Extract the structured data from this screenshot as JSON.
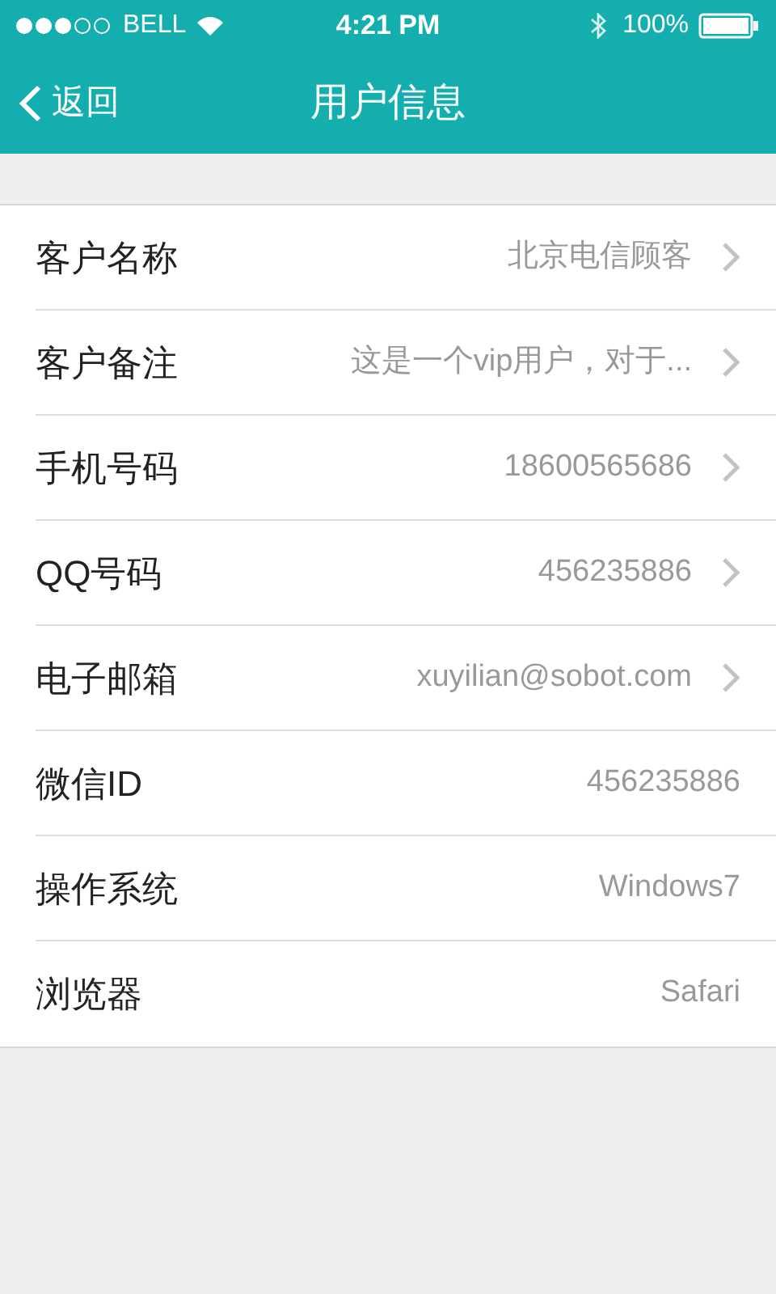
{
  "status_bar": {
    "carrier": "BELL",
    "time": "4:21 PM",
    "battery": "100%"
  },
  "nav": {
    "back": "返回",
    "title": "用户信息"
  },
  "rows": [
    {
      "label": "客户名称",
      "value": "北京电信顾客",
      "kind": "link"
    },
    {
      "label": "客户备注",
      "value": "这是一个vip用户，对于...",
      "kind": "link"
    },
    {
      "label": "手机号码",
      "value": "18600565686",
      "kind": "link"
    },
    {
      "label": "QQ号码",
      "value": "456235886",
      "kind": "link"
    },
    {
      "label": "电子邮箱",
      "value": "xuyilian@sobot.com",
      "kind": "link"
    },
    {
      "label": "微信ID",
      "value": "456235886",
      "kind": "plain"
    },
    {
      "label": "操作系统",
      "value": "Windows7",
      "kind": "plain"
    },
    {
      "label": "浏览器",
      "value": "Safari",
      "kind": "plain"
    }
  ]
}
